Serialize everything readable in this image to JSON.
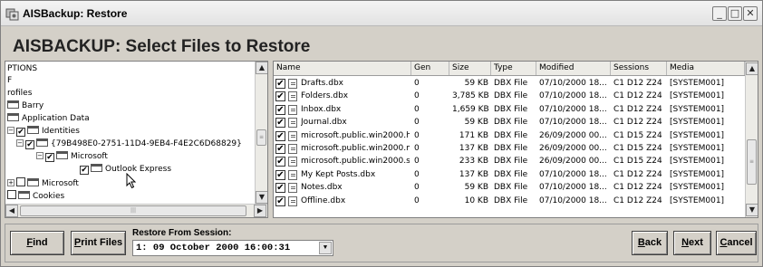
{
  "window": {
    "title": "AISBackup: Restore",
    "heading": "AISBACKUP:  Select Files to Restore",
    "controls": {
      "minimize": "_",
      "maximize": "□",
      "close": "✕"
    }
  },
  "tree": {
    "nodes": [
      {
        "text": "PTIONS"
      },
      {
        "text": "F"
      },
      {
        "text": "rofiles"
      },
      {
        "text": "Barry"
      },
      {
        "text": "Application Data"
      },
      {
        "text": "Identities"
      },
      {
        "text": "{79B498E0-2751-11D4-9EB4-F4E2C6D68829}"
      },
      {
        "text": "Microsoft"
      },
      {
        "text": "Outlook Express"
      },
      {
        "text": "Microsoft"
      },
      {
        "text": "Cookies"
      }
    ],
    "icons": {
      "expand": "+",
      "collapse": "−",
      "checked": "✔",
      "folder": "folder-icon"
    }
  },
  "list": {
    "columns": [
      "Name",
      "Gen",
      "Size",
      "Type",
      "Modified",
      "Sessions",
      "Media"
    ],
    "rows": [
      {
        "name": "Drafts.dbx",
        "gen": "0",
        "size": "59 KB",
        "type": "DBX File",
        "modified": "07/10/2000 18...",
        "sessions": "C1 D12 Z24",
        "media": "[SYSTEM001]"
      },
      {
        "name": "Folders.dbx",
        "gen": "0",
        "size": "3,785 KB",
        "type": "DBX File",
        "modified": "07/10/2000 18...",
        "sessions": "C1 D12 Z24",
        "media": "[SYSTEM001]"
      },
      {
        "name": "Inbox.dbx",
        "gen": "0",
        "size": "1,659 KB",
        "type": "DBX File",
        "modified": "07/10/2000 18...",
        "sessions": "C1 D12 Z24",
        "media": "[SYSTEM001]"
      },
      {
        "name": "Journal.dbx",
        "gen": "0",
        "size": "59 KB",
        "type": "DBX File",
        "modified": "07/10/2000 18...",
        "sessions": "C1 D12 Z24",
        "media": "[SYSTEM001]"
      },
      {
        "name": "microsoft.public.win2000.h...",
        "gen": "0",
        "size": "171 KB",
        "type": "DBX File",
        "modified": "26/09/2000 00...",
        "sessions": "C1 D15 Z24",
        "media": "[SYSTEM001]"
      },
      {
        "name": "microsoft.public.win2000.m...",
        "gen": "0",
        "size": "137 KB",
        "type": "DBX File",
        "modified": "26/09/2000 00...",
        "sessions": "C1 D15 Z24",
        "media": "[SYSTEM001]"
      },
      {
        "name": "microsoft.public.win2000.se...",
        "gen": "0",
        "size": "233 KB",
        "type": "DBX File",
        "modified": "26/09/2000 00...",
        "sessions": "C1 D15 Z24",
        "media": "[SYSTEM001]"
      },
      {
        "name": "My Kept Posts.dbx",
        "gen": "0",
        "size": "137 KB",
        "type": "DBX File",
        "modified": "07/10/2000 18...",
        "sessions": "C1 D12 Z24",
        "media": "[SYSTEM001]"
      },
      {
        "name": "Notes.dbx",
        "gen": "0",
        "size": "59 KB",
        "type": "DBX File",
        "modified": "07/10/2000 18...",
        "sessions": "C1 D12 Z24",
        "media": "[SYSTEM001]"
      },
      {
        "name": "Offline.dbx",
        "gen": "0",
        "size": "10 KB",
        "type": "DBX File",
        "modified": "07/10/2000 18...",
        "sessions": "C1 D12 Z24",
        "media": "[SYSTEM001]"
      }
    ],
    "check_glyph": "✔"
  },
  "bottom": {
    "find": {
      "accel": "F",
      "rest": "ind"
    },
    "print": {
      "accel": "P",
      "rest": "rint Files"
    },
    "session_label": "Restore From Session:",
    "session_value": "1: 09 October 2000 16:00:31",
    "back": {
      "accel": "B",
      "rest": "ack"
    },
    "next": {
      "accel": "N",
      "rest": "ext"
    },
    "cancel": {
      "accel": "C",
      "rest": "ancel"
    }
  },
  "scroll": {
    "up": "▲",
    "down": "▼",
    "left": "◀",
    "right": "▶",
    "dropdown": "▼"
  }
}
